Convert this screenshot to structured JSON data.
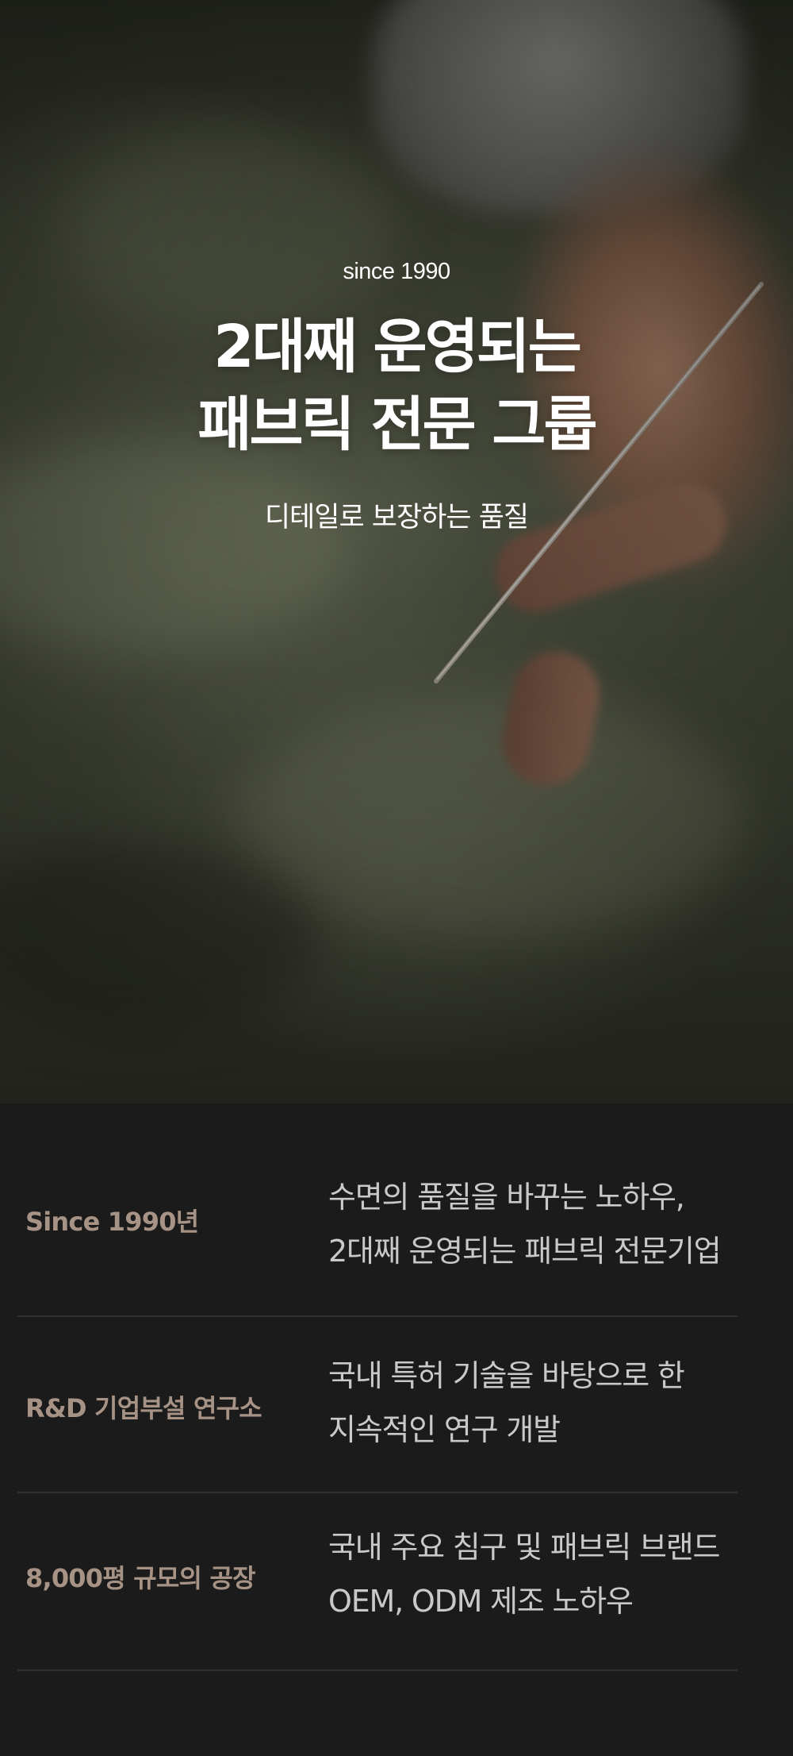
{
  "hero": {
    "eyebrow": "since 1990",
    "title_line1": "2대째 운영되는",
    "title_line2": "패브릭 전문 그룹",
    "subtitle": "디테일로 보장하는 품질",
    "image_subject": "hand-sewing-fabric-photo"
  },
  "features": [
    {
      "label": "Since 1990년",
      "desc_line1": "수면의 품질을 바꾸는 노하우,",
      "desc_line2": "2대째 운영되는 패브릭 전문기업"
    },
    {
      "label": "R&D 기업부설 연구소",
      "desc_line1": "국내 특허 기술을 바탕으로 한",
      "desc_line2": "지속적인 연구 개발"
    },
    {
      "label": "8,000평 규모의 공장",
      "desc_line1": "국내 주요 침구 및 패브릭 브랜드",
      "desc_line2": "OEM, ODM 제조 노하우"
    }
  ],
  "colors": {
    "background": "#1b1b1b",
    "label_accent": "#a79385",
    "description_text": "#c9c9c9",
    "divider": "#2f2f2f",
    "hero_text": "#ffffff"
  }
}
